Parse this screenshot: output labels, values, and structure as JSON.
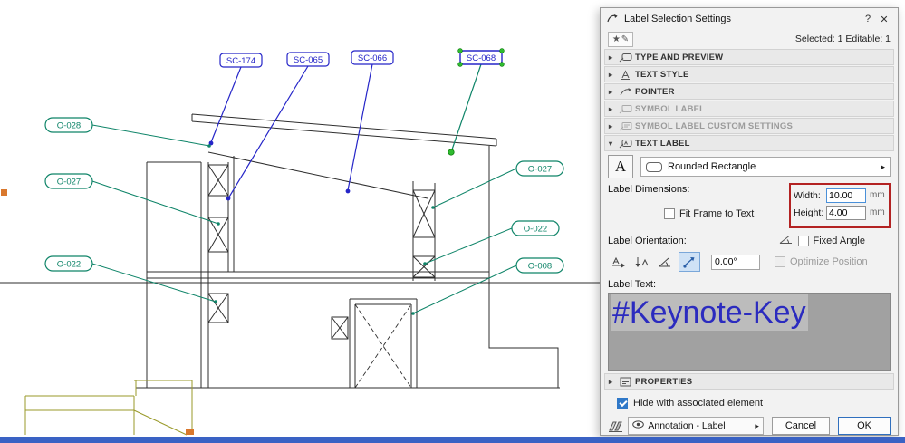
{
  "drawing": {
    "blue_labels": [
      {
        "text": "SC-174"
      },
      {
        "text": "SC-065"
      },
      {
        "text": "SC-066"
      },
      {
        "text": "SC-068"
      }
    ],
    "green_labels": [
      {
        "text": "O-028"
      },
      {
        "text": "O-027"
      },
      {
        "text": "O-022"
      },
      {
        "text": "O-027"
      },
      {
        "text": "O-022"
      },
      {
        "text": "O-008"
      }
    ]
  },
  "dialog": {
    "title": "Label Selection Settings",
    "help": "?",
    "close": "✕",
    "status": "Selected: 1 Editable: 1",
    "sections": {
      "type_and_preview": "TYPE AND PREVIEW",
      "text_style": "TEXT STYLE",
      "pointer": "POINTER",
      "symbol_label": "SYMBOL LABEL",
      "symbol_label_custom": "SYMBOL LABEL CUSTOM SETTINGS",
      "text_label": "TEXT LABEL",
      "properties": "PROPERTIES"
    },
    "text_label_panel": {
      "frame_letter": "A",
      "frame_style": "Rounded Rectangle",
      "dimensions_caption": "Label Dimensions:",
      "width_label": "Width:",
      "width_value": "10.00",
      "width_unit": "mm",
      "height_label": "Height:",
      "height_value": "4.00",
      "height_unit": "mm",
      "fit_frame_label": "Fit Frame to Text",
      "orientation_caption": "Label Orientation:",
      "fixed_angle_label": "Fixed Angle",
      "angle_value": "0.00°",
      "optimize_label": "Optimize Position",
      "label_text_caption": "Label Text:",
      "label_text_value": "#Keynote-Key"
    },
    "footer": {
      "hide_label": "Hide with associated element",
      "layer_name": "Annotation - Label",
      "cancel_label": "Cancel",
      "ok_label": "OK"
    },
    "icons": {
      "collapsed_arrow": "▸",
      "expanded_arrow": "▾",
      "flyout_arrow": "▸",
      "star": "★",
      "pen": "✎"
    },
    "accent_colors": {
      "highlight_red": "#b32222",
      "label_blue": "#2525c8",
      "label_green": "#0e8468"
    }
  }
}
